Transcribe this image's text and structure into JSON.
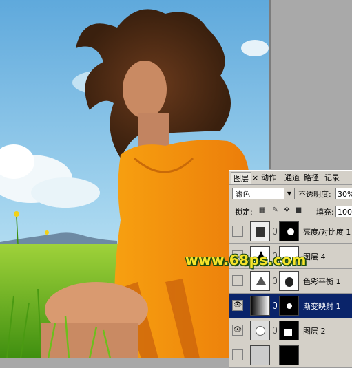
{
  "panel": {
    "tabs": [
      {
        "label": "图层"
      },
      {
        "label": "×"
      },
      {
        "label": "动作"
      },
      {
        "label": "通道"
      },
      {
        "label": "路径"
      },
      {
        "label": "记录"
      }
    ],
    "blend_mode": "滤色",
    "opacity_label": "不透明度:",
    "opacity_value": "30%",
    "lock_label": "锁定:",
    "fill_label": "填充:",
    "fill_value": "100%",
    "layers": [
      {
        "name": "亮度/对比度 1",
        "visible": false,
        "selected": false
      },
      {
        "name": "图层 4",
        "visible": false,
        "selected": false
      },
      {
        "name": "色彩平衡 1",
        "visible": false,
        "selected": false
      },
      {
        "name": "渐变映射 1",
        "visible": true,
        "selected": true
      },
      {
        "name": "图层 2",
        "visible": true,
        "selected": false
      }
    ]
  },
  "watermark": "www.68ps.com",
  "colors": {
    "selection": "#0a246a",
    "panel_bg": "#d4d0c8",
    "sky": "#8cc6e6",
    "grass": "#7fc12a",
    "dress": "#f59a12",
    "watermark": "#f6e42a"
  }
}
